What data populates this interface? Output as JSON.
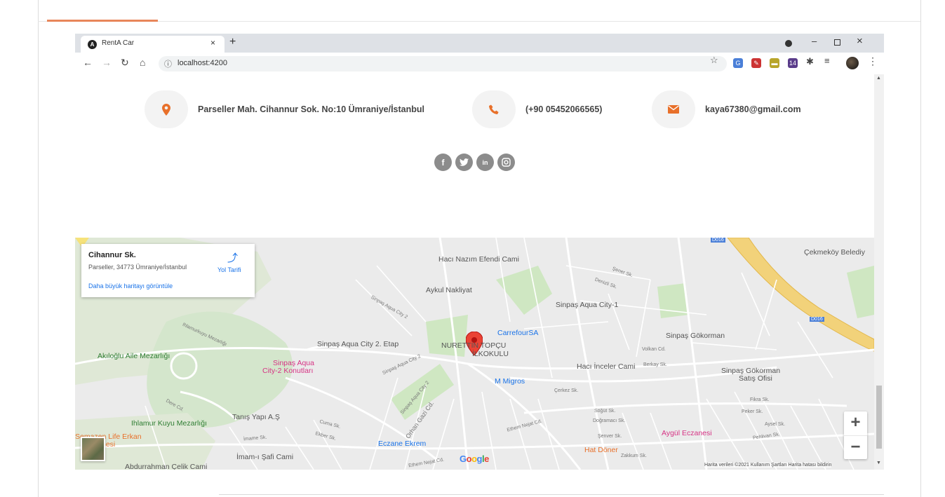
{
  "browser": {
    "tab_title": "RentA Car",
    "tab_close": "×",
    "new_tab": "+",
    "url": "localhost:4200",
    "win_min": "–",
    "win_close": "×",
    "ext_badge": "14"
  },
  "contact": {
    "address": "Parseller Mah. Cihannur Sok. No:10 Ümraniye/İstanbul",
    "phone": "(+90 05452066565)",
    "email": "kaya67380@gmail.com",
    "icon_color": "#e8702a"
  },
  "socials": [
    "f",
    "t",
    "in",
    "ig"
  ],
  "map": {
    "place_title": "Cihannur Sk.",
    "place_address": "Parseller, 34773 Ümraniye/İstanbul",
    "larger_map_link": "Daha büyük haritayı görüntüle",
    "directions_label": "Yol Tarifi",
    "zoom_in": "+",
    "zoom_out": "−",
    "google_logo": "Google",
    "attribution": "Harita verileri ©2021   Kullanım Şartları   Harita hatası bildirin",
    "labels": {
      "haci_nazim": "Hacı Nazım Efendi Cami",
      "aykul": "Aykul Nakliyat",
      "sinpas_aqua1": "Sinpaş Aqua City-1",
      "carrefour": "CarrefourSA",
      "sinpas_gokorman": "Sinpaş Gökorman",
      "sinpas_city2": "Sinpaş Aqua City 2. Etap",
      "nuret": "NURETTİN TOPÇU",
      "ilkokulu": "İLKOKULU",
      "akiloglu": "Akıloğlu Aile Mezarlığı",
      "sinpas_konut1": "Sinpaş Aqua",
      "sinpas_konut2": "City-2 Konutları",
      "haci_inceler": "Hacı İnceler Cami",
      "sinpas_satis1": "Sinpaş Gökorman",
      "sinpas_satis2": "Satış Ofisi",
      "migros": "M Migros",
      "cekmekoy": "Çekmeköy Belediy",
      "ihlamur": "Ihlamur Kuyu Mezarlığı",
      "tanis": "Tanış Yapı A.Ş",
      "semazen1": "Semazen Life Erkan",
      "semazen2": "nesi",
      "eczane_ekrem": "Eczane Ekrem",
      "aygul": "Aygül Eczanesi",
      "hat_doner": "Hat Döner",
      "imami_safi": "İmam-ı Şafi Cami",
      "abdurrahman": "Abdurrahman Çelik Cami",
      "d016a": "D016",
      "d016b": "D016"
    },
    "streets": {
      "s1": "Sinpaş Aqua City 2",
      "s2": "Sinpaş Aqua City 2",
      "s3": "Sinpaş Aqua City 2",
      "s4": "Ihlamurkuyu Mezarlığı",
      "s5": "Orhan Gazi Cd.",
      "s6": "Ethem Nejat Cd.",
      "s7": "Ethem Nejat Cd.",
      "s8": "Şener Sk.",
      "s9": "Denizli Sk.",
      "s10": "Volkan Cd.",
      "s11": "Berkay Sk.",
      "s12": "Söğüt Sk.",
      "s13": "Doğramacı Sk.",
      "s14": "Şenver Sk.",
      "s15": "Zakkum Sk.",
      "s16": "Cuma Sk.",
      "s17": "Ekber Sk.",
      "s18": "İmame Sk.",
      "s19": "Dere Cd.",
      "s20": "Peker Sk.",
      "s21": "Fikra Sk.",
      "s22": "Aysel Sk.",
      "s23": "Çerkez Sk.",
      "s24": "Pehlivan Sk."
    }
  }
}
